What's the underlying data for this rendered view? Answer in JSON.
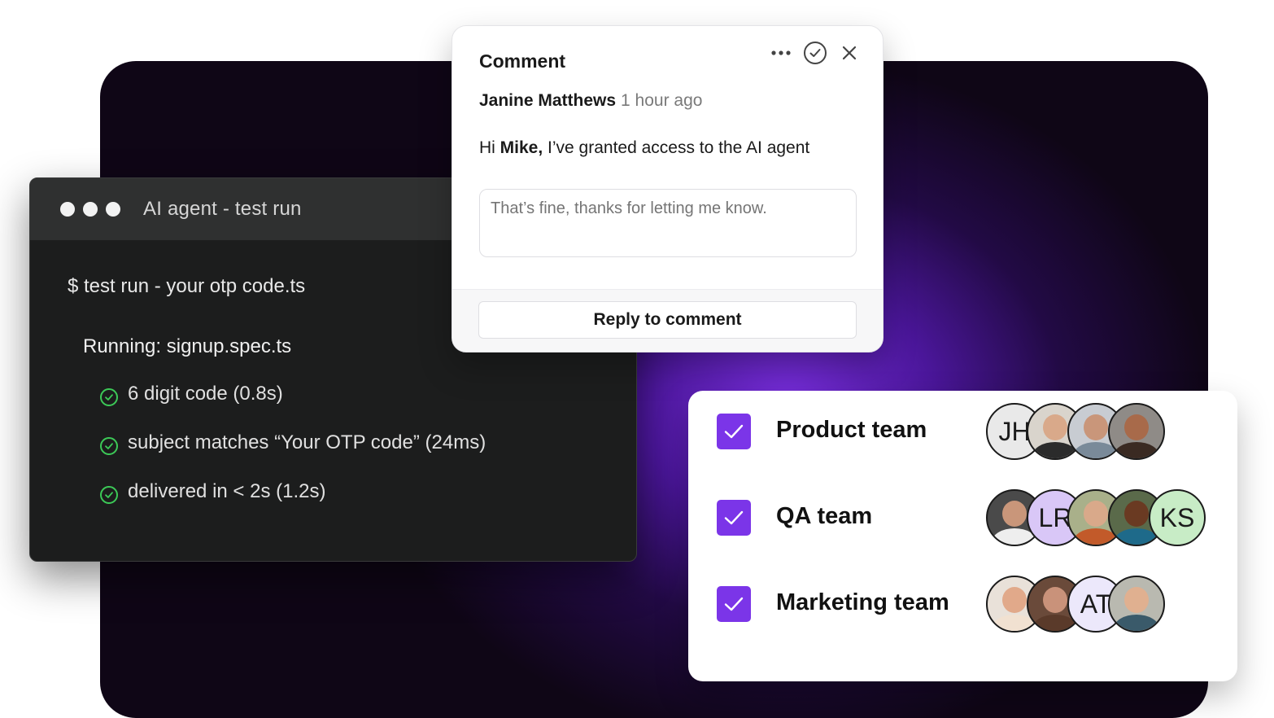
{
  "terminal": {
    "title": "AI agent - test run",
    "command": "$ test run - your otp code.ts",
    "running": "Running: signup.spec.ts",
    "checks": [
      "6 digit code (0.8s)",
      "subject matches “Your OTP code” (24ms)",
      "delivered in < 2s (1.2s)"
    ]
  },
  "comment": {
    "title": "Comment",
    "author": "Janine Matthews",
    "time": "1 hour ago",
    "message_prefix": "Hi ",
    "message_name": "Mike,",
    "message_rest": " I’ve granted access to the AI agent",
    "reply_placeholder": "That’s fine, thanks for letting me know.",
    "reply_button": "Reply to comment"
  },
  "teams": [
    {
      "name": "Product team",
      "checked": true,
      "avatars": [
        {
          "type": "initials",
          "text": "JH",
          "bg": "#e9e9e9"
        },
        {
          "type": "photo",
          "skin": "#d9a98a",
          "shirt": "#2b2b2b",
          "bg": "#d9d4cc"
        },
        {
          "type": "photo",
          "skin": "#c9967a",
          "shirt": "#7a8a99",
          "bg": "#c8ccd2"
        },
        {
          "type": "photo",
          "skin": "#a86a4a",
          "shirt": "#3a2a22",
          "bg": "#8f8b87"
        }
      ]
    },
    {
      "name": "QA team",
      "checked": true,
      "avatars": [
        {
          "type": "photo",
          "skin": "#c9967a",
          "shirt": "#eeeeee",
          "bg": "#4a4a4a"
        },
        {
          "type": "initials",
          "text": "LR",
          "bg": "#d9c7f7"
        },
        {
          "type": "photo",
          "skin": "#d9a98a",
          "shirt": "#c25a2a",
          "bg": "#a9b08a"
        },
        {
          "type": "photo",
          "skin": "#6a3a22",
          "shirt": "#1e6a8a",
          "bg": "#5a6a4a"
        },
        {
          "type": "initials",
          "text": "KS",
          "bg": "#c8ecc6"
        }
      ]
    },
    {
      "name": "Marketing team",
      "checked": true,
      "avatars": [
        {
          "type": "photo",
          "skin": "#e1a98a",
          "shirt": "#f1e1d1",
          "bg": "#e9e1d9"
        },
        {
          "type": "photo",
          "skin": "#c9927a",
          "shirt": "#5a3a2a",
          "bg": "#6a4a3a"
        },
        {
          "type": "initials",
          "text": "AT",
          "bg": "#ece8fb"
        },
        {
          "type": "photo",
          "skin": "#e0b090",
          "shirt": "#3a5a6a",
          "bg": "#b9b9b0"
        }
      ]
    }
  ],
  "colors": {
    "accent": "#7b35e8",
    "success": "#3cc957"
  }
}
